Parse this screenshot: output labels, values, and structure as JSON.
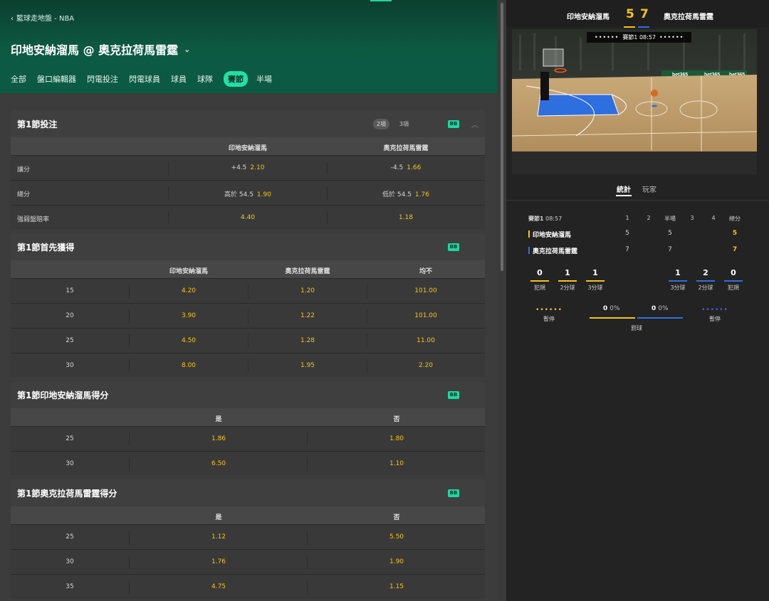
{
  "header": {
    "breadcrumb": "籃球走地盤 - NBA",
    "title": "印地安納溜馬 @ 奧克拉荷馬雷霆",
    "tabs": [
      "全部",
      "盤口編輯器",
      "閃電投注",
      "閃電球員",
      "球員",
      "球隊",
      "賽節",
      "半場"
    ],
    "active_tab": "賽節"
  },
  "market1": {
    "title": "第1節投注",
    "pill_a": "2項",
    "pill_b": "3項",
    "badge": "BB",
    "columns": [
      "印地安納溜馬",
      "奧克拉荷馬雷霆"
    ],
    "rows": [
      {
        "label": "讓分",
        "a_hc": "+4.5",
        "a_odds": "2.10",
        "b_hc": "-4.5",
        "b_odds": "1.66"
      },
      {
        "label": "總分",
        "a_hc": "高於 54.5",
        "a_odds": "1.90",
        "b_hc": "低於 54.5",
        "b_odds": "1.76"
      },
      {
        "label": "強弱盤賠率",
        "a_hc": "",
        "a_odds": "4.40",
        "b_hc": "",
        "b_odds": "1.18"
      }
    ]
  },
  "market2": {
    "title": "第1節首先獲得",
    "badge": "BB",
    "columns": [
      "印地安納溜馬",
      "奧克拉荷馬雷霆",
      "均不"
    ],
    "rows": [
      {
        "label": "15",
        "v": [
          "4.20",
          "1.20",
          "101.00"
        ]
      },
      {
        "label": "20",
        "v": [
          "3.90",
          "1.22",
          "101.00"
        ]
      },
      {
        "label": "25",
        "v": [
          "4.50",
          "1.28",
          "11.00"
        ]
      },
      {
        "label": "30",
        "v": [
          "8.00",
          "1.95",
          "2.20"
        ]
      }
    ]
  },
  "market3": {
    "title": "第1節印地安納溜馬得分",
    "badge": "BB",
    "columns": [
      "是",
      "否"
    ],
    "rows": [
      {
        "label": "25",
        "v": [
          "1.86",
          "1.80"
        ]
      },
      {
        "label": "30",
        "v": [
          "6.50",
          "1.10"
        ]
      }
    ]
  },
  "market4": {
    "title": "第1節奧克拉荷馬雷霆得分",
    "badge": "BB",
    "columns": [
      "是",
      "否"
    ],
    "rows": [
      {
        "label": "25",
        "v": [
          "1.12",
          "5.50"
        ]
      },
      {
        "label": "30",
        "v": [
          "1.76",
          "1.90"
        ]
      },
      {
        "label": "35",
        "v": [
          "4.75",
          "1.15"
        ]
      }
    ]
  },
  "scoreboard": {
    "home": "印地安納溜馬",
    "away": "奧克拉荷馬雷霆",
    "home_score": "5",
    "away_score": "7",
    "clock_label": "賽節1 08:57",
    "clock_dots": "••••••",
    "ad": "bet365"
  },
  "stats": {
    "tabs": [
      "統計",
      "玩家"
    ],
    "period": "賽節1",
    "clock": "08:57",
    "headers": [
      "1",
      "2",
      "半場",
      "3",
      "4",
      "總分"
    ],
    "home": {
      "name": "印地安納溜馬",
      "q1": "5",
      "half": "5",
      "total": "5",
      "color": "#f5c518"
    },
    "away": {
      "name": "奧克拉荷馬雷霆",
      "q1": "7",
      "half": "7",
      "total": "7",
      "color": "#2f6fe0"
    },
    "home_fouls": "0",
    "home_2pt": "1",
    "home_3pt": "1",
    "away_3pt": "1",
    "away_2pt": "2",
    "away_fouls": "0",
    "lbl_fouls": "犯規",
    "lbl_2pt": "2分球",
    "lbl_3pt": "3分球",
    "timeout_label": "暫停",
    "timeout_dots": "••••••",
    "home_ft": "0",
    "home_ft_pct": "0%",
    "away_ft": "0",
    "away_ft_pct": "0%",
    "ft_label": "罰球"
  }
}
